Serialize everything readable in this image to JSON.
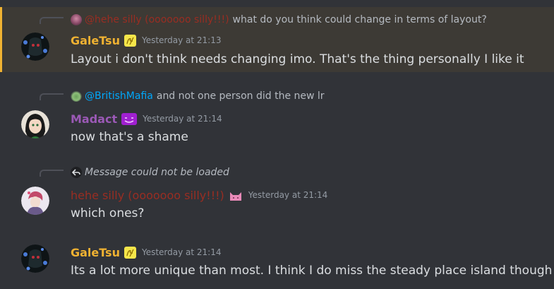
{
  "messages": [
    {
      "reply": {
        "ref_user": "@hehe silly (ooooooo silly!!!)",
        "text": "what do you think could change in terms of layout?"
      },
      "username": "GaleTsu",
      "timestamp": "Yesterday at 21:13",
      "content": "Layout i don't think needs changing imo. That's the thing personally I like it"
    },
    {
      "reply": {
        "ref_user": "@BritishMafia",
        "text": "and not one person did the new lr"
      },
      "username": "Madact",
      "timestamp": "Yesterday at 21:14",
      "content": "now that's a shame"
    },
    {
      "reply": {
        "text": "Message could not be loaded"
      },
      "username": "hehe silly (ooooooo silly!!!)",
      "timestamp": "Yesterday at 21:14",
      "content": "which ones?"
    },
    {
      "username": "GaleTsu",
      "timestamp": "Yesterday at 21:14",
      "content": "Its a lot more unique than most. I think I do miss the steady place island though"
    }
  ],
  "colors": {
    "background": "#313338",
    "highlight": "#3d3a35",
    "mention_bar": "#f0b232",
    "galetsu": "#f0b232",
    "madact": "#9b59b6",
    "hehe": "#992d22",
    "mention": "#00a8fc",
    "text": "#dbdee1",
    "muted": "#949ba4"
  }
}
